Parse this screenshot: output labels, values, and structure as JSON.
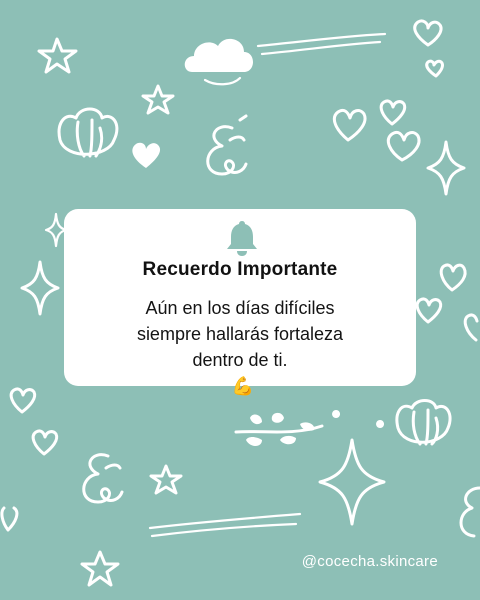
{
  "card": {
    "title": "Recuerdo Importante",
    "message_lines": [
      "Aún en los días difíciles",
      "siempre hallarás fortaleza",
      "dentro de ti."
    ],
    "emoji": "💪"
  },
  "footer": {
    "handle": "@cocecha.skincare"
  },
  "colors": {
    "background": "#8dbfb6",
    "card": "#ffffff",
    "bell": "#8dbfb6",
    "text": "#141414",
    "doodles": "#ffffff"
  },
  "icons": [
    "bell-icon",
    "flexed-biceps-icon",
    "star-doodle",
    "heart-doodle",
    "cloud-doodle",
    "sparkle-doodle",
    "flower-doodle",
    "swirl-doodle"
  ]
}
